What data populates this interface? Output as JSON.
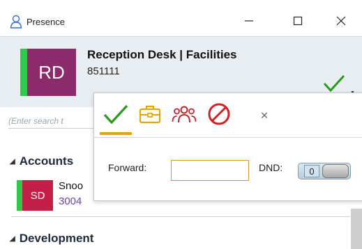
{
  "window": {
    "title": "Presence",
    "app_icon": "person-outline-icon",
    "controls": {
      "minimize_icon": "minimize-icon",
      "maximize_icon": "maximize-icon",
      "close_icon": "close-icon"
    }
  },
  "header": {
    "initials": "RD",
    "avatar_color": "#8c2a6c",
    "status_color": "#2ec84b",
    "name": "Reception Desk | Facilities",
    "extension": "851111",
    "status_icon": "available-check-icon"
  },
  "search": {
    "placeholder": "(Enter search t"
  },
  "groups": [
    {
      "label": "Accounts",
      "contacts": [
        {
          "initials": "SD",
          "avatar_color": "#c41f46",
          "status_color": "#2ec84b",
          "name": "Snoo",
          "extension": "3004"
        }
      ]
    },
    {
      "label": "Development",
      "contacts": []
    }
  ],
  "status_popup": {
    "tabs": [
      {
        "name": "available",
        "icon": "check-icon",
        "color": "#2a9a1e",
        "selected": true
      },
      {
        "name": "away",
        "icon": "briefcase-icon",
        "color": "#e3a700"
      },
      {
        "name": "in-meeting",
        "icon": "people-group-icon",
        "color": "#c0272d"
      },
      {
        "name": "busy",
        "icon": "no-entry-icon",
        "color": "#d11f26"
      }
    ],
    "close_symbol": "×",
    "forward_label": "Forward:",
    "forward_value": "",
    "dnd_label": "DND:",
    "dnd_value": "0"
  }
}
